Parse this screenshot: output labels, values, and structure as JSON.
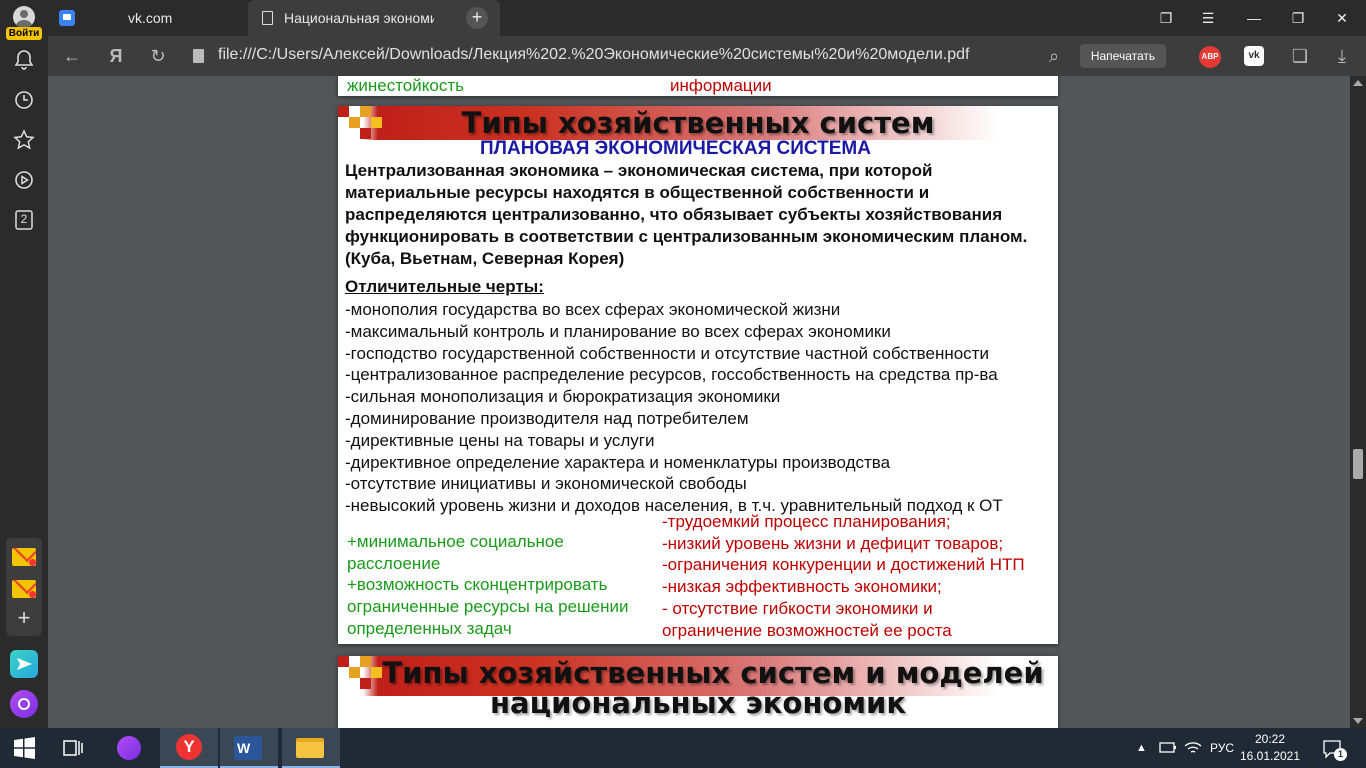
{
  "sidebar": {
    "login_label": "Войти",
    "badge_count": "2"
  },
  "tabs": [
    {
      "title": "vk.com"
    },
    {
      "title": "Национальная экономика"
    }
  ],
  "address_bar": {
    "url": "file:///C:/Users/Алексей/Downloads/Лекция%202.%20Экономические%20системы%20и%20модели.pdf",
    "print_label": "Напечатать",
    "abp_label": "ABP",
    "vk_label": "vk"
  },
  "pdf": {
    "prev_page": {
      "left_text": "жинестойкость",
      "right_text": "информации"
    },
    "slide": {
      "title": "Типы хозяйственных систем",
      "subtitle": "ПЛАНОВАЯ ЭКОНОМИЧЕСКАЯ СИСТЕМА",
      "definition": "Централизованная экономика – экономическая система, при которой материальные ресурсы находятся в общественной собственности и распределяются централизованно, что обязывает субъекты хозяйствования функционировать в соответствии с централизованным экономическим планом. (Куба, Вьетнам, Северная Корея)",
      "features_heading": "Отличительные черты:",
      "features": [
        "-монополия государства во всех сферах экономической жизни",
        "-максимальный контроль и планирование во всех сферах экономики",
        "-господство государственной собственности и отсутствие частной собственности",
        "-централизованное распределение ресурсов, госсобственность на средства пр-ва",
        "-сильная монополизация и бюрократизация экономики",
        "-доминирование производителя над потребителем",
        "-директивные цены на товары и услуги",
        "-директивное определение характера и номенклатуры производства",
        "-отсутствие инициативы и экономической свободы",
        "-невысокий уровень жизни и доходов населения, в т.ч. уравнительный подход к ОТ"
      ],
      "pros": [
        "+минимальное социальное расслоение",
        "+возможность сконцентрировать ограниченные ресурсы на решении определенных задач"
      ],
      "cons": [
        "-трудоемкий процесс планирования;",
        "-низкий уровень жизни и дефицит товаров;",
        "-ограничения конкуренции и достижений НТП",
        "-низкая эффективность экономики;",
        "- отсутствие гибкости экономики и",
        "ограничение возможностей ее роста"
      ]
    },
    "next_slide": {
      "title_line1": "Типы хозяйственных систем и моделей",
      "title_line2": "национальных экономик"
    }
  },
  "taskbar": {
    "language": "РУС",
    "time": "20:22",
    "date": "16.01.2021",
    "notification_count": "1"
  },
  "colors": {
    "accent_red": "#c00000",
    "accent_green": "#1a9a1a",
    "subtitle_blue": "#1a1aa6",
    "yandex_yellow": "#f5c400"
  }
}
